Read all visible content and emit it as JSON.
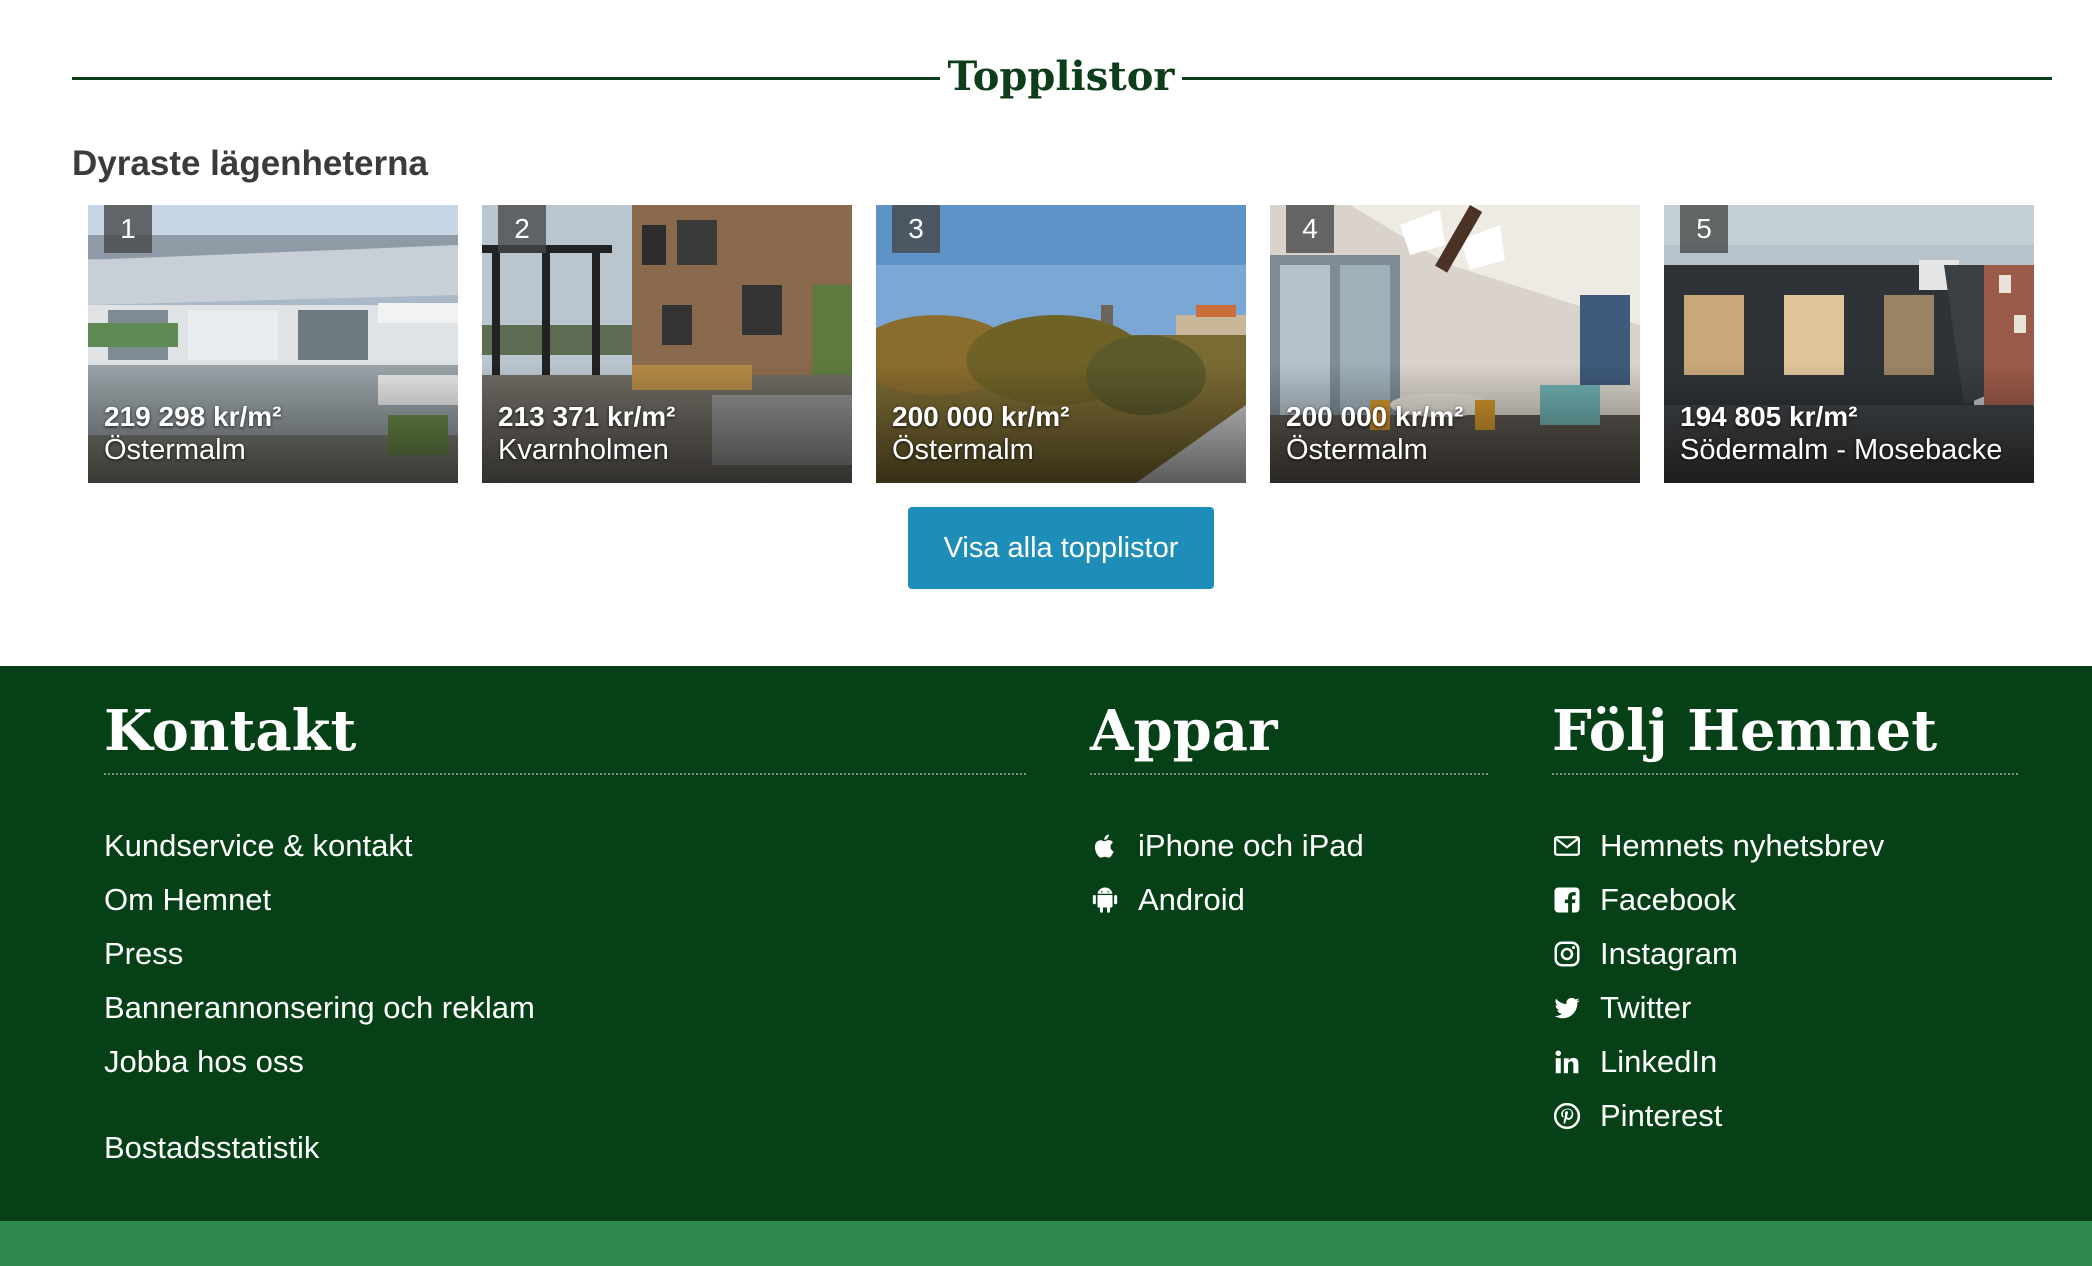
{
  "colors": {
    "heading_green": "#0d3d1a",
    "footer_green": "#064016",
    "bottom_bar_green": "#2e8a4c",
    "button_blue": "#1e8db8"
  },
  "section": {
    "title": "Topplistor",
    "list_title": "Dyraste lägenheterna",
    "cards": [
      {
        "rank": "1",
        "price": "219 298 kr/m²",
        "area": "Östermalm"
      },
      {
        "rank": "2",
        "price": "213 371 kr/m²",
        "area": "Kvarnholmen"
      },
      {
        "rank": "3",
        "price": "200 000 kr/m²",
        "area": "Östermalm"
      },
      {
        "rank": "4",
        "price": "200 000 kr/m²",
        "area": "Östermalm"
      },
      {
        "rank": "5",
        "price": "194 805 kr/m²",
        "area": "Södermalm - Mosebacke"
      }
    ],
    "button_label": "Visa alla topplistor"
  },
  "footer": {
    "kontakt": {
      "title": "Kontakt",
      "links": [
        "Kundservice & kontakt",
        "Om Hemnet",
        "Press",
        "Bannerannonsering och reklam",
        "Jobba hos oss",
        "Bostadsstatistik"
      ]
    },
    "appar": {
      "title": "Appar",
      "links": [
        {
          "label": "iPhone och iPad",
          "icon": "apple-icon"
        },
        {
          "label": "Android",
          "icon": "android-icon"
        }
      ]
    },
    "folj": {
      "title": "Följ Hemnet",
      "links": [
        {
          "label": "Hemnets nyhetsbrev",
          "icon": "envelope-icon"
        },
        {
          "label": "Facebook",
          "icon": "facebook-icon"
        },
        {
          "label": "Instagram",
          "icon": "instagram-icon"
        },
        {
          "label": "Twitter",
          "icon": "twitter-icon"
        },
        {
          "label": "LinkedIn",
          "icon": "linkedin-icon"
        },
        {
          "label": "Pinterest",
          "icon": "pinterest-icon"
        }
      ]
    }
  }
}
